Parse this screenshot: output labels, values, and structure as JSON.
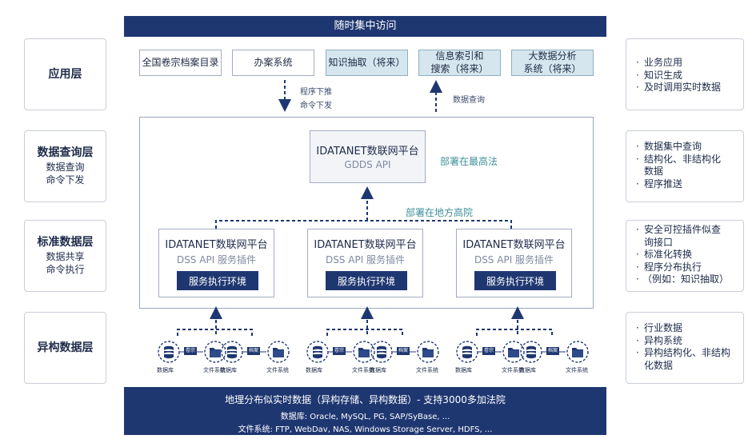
{
  "top_banner": "随时集中访问",
  "layers": [
    {
      "title": "应用层",
      "sub": []
    },
    {
      "title": "数据查询层",
      "sub": [
        "数据查询",
        "命令下发"
      ]
    },
    {
      "title": "标准数据层",
      "sub": [
        "数据共享",
        "命令执行"
      ]
    },
    {
      "title": "异构数据层",
      "sub": []
    }
  ],
  "apps": [
    {
      "label": "全国卷宗档案目录",
      "future": false
    },
    {
      "label": "办案系统",
      "future": false
    },
    {
      "label": "知识抽取（将来）",
      "future": true
    },
    {
      "label": "信息索引和\n搜索（将来）",
      "future": true
    },
    {
      "label": "大数据分析\n系统（将来）",
      "future": true
    }
  ],
  "arrow_down_labels": [
    "程序下推",
    "命令下发"
  ],
  "arrow_up_label": "数据查询",
  "gdds": {
    "title": "IDATANET数联网平台",
    "sub": "GDDS API",
    "note": "部署在最高法"
  },
  "local_note": "部署在地方高院",
  "dss_nodes": [
    {
      "title": "IDATANET数联网平台",
      "sub": "DSS API 服务插件",
      "env": "服务执行环境"
    },
    {
      "title": "IDATANET数联网平台",
      "sub": "DSS API 服务插件",
      "env": "服务执行环境"
    },
    {
      "title": "IDATANET数联网平台",
      "sub": "DSS API 服务插件",
      "env": "服务执行环境"
    }
  ],
  "sources": {
    "db_label": "数据库",
    "fs_label": "文件系统",
    "tags": [
      "卷宗",
      "档案"
    ]
  },
  "bottom": {
    "title": "地理分布似实时数据（异构存储、异构数据）- 支持3000多加法院",
    "line1": "数据库: Oracle, MySQL, PG, SAP/SyBase, ...",
    "line2": "文件系统: FTP, WebDav, NAS, Windows Storage Server, HDFS, ..."
  },
  "notes": [
    [
      "业务应用",
      "知识生成",
      "及时调用实时数据"
    ],
    [
      "数据集中查询",
      "结构化、非结构化\n数据",
      "程序推送"
    ],
    [
      "安全可控插件似查\n询接口",
      "标准化转换",
      "程序分布执行",
      "（例如：知识抽取）"
    ],
    [
      "行业数据",
      "异构系统",
      "异构结构化、非结构\n化数据"
    ]
  ],
  "colors": {
    "navy": "#1f3771",
    "future_fill": "#d6e6ee",
    "teal": "#3e8f9a"
  }
}
